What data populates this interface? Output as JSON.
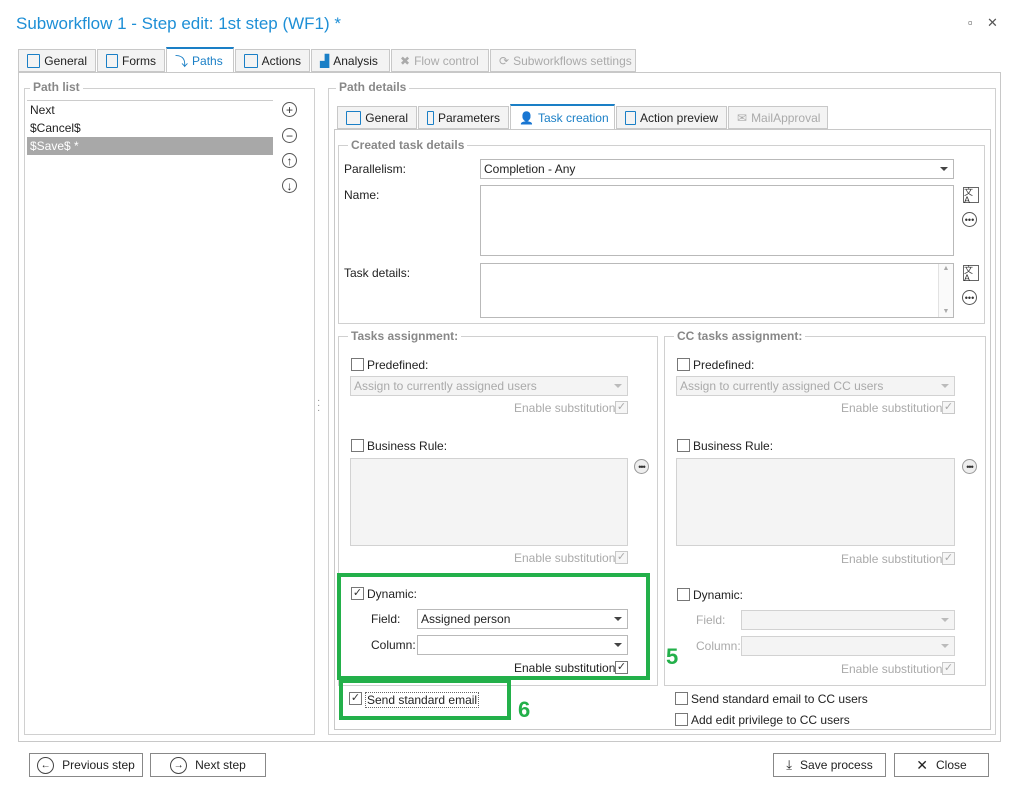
{
  "window": {
    "title": "Subworkflow 1 - Step edit: 1st step (WF1) *"
  },
  "main_tabs": [
    {
      "label": "General",
      "icon": "window-icon"
    },
    {
      "label": "Forms",
      "icon": "form-icon"
    },
    {
      "label": "Paths",
      "icon": "paths-icon",
      "active": true
    },
    {
      "label": "Actions",
      "icon": "actions-icon"
    },
    {
      "label": "Analysis",
      "icon": "analysis-icon"
    },
    {
      "label": "Flow control",
      "icon": "flow-control-icon",
      "disabled": true
    },
    {
      "label": "Subworkflows settings",
      "icon": "subworkflows-icon",
      "disabled": true
    }
  ],
  "path_list": {
    "title": "Path list",
    "items": [
      "Next",
      "$Cancel$",
      "$Save$ *"
    ],
    "selected_index": 2
  },
  "path_details": {
    "title": "Path details",
    "tabs": [
      {
        "label": "General"
      },
      {
        "label": "Parameters"
      },
      {
        "label": "Task creation",
        "active": true
      },
      {
        "label": "Action preview"
      },
      {
        "label": "MailApproval",
        "disabled": true
      }
    ],
    "created_task": {
      "title": "Created task details",
      "parallelism_label": "Parallelism:",
      "parallelism_value": "Completion - Any",
      "name_label": "Name:",
      "details_label": "Task details:"
    },
    "tasks_assignment": {
      "title": "Tasks assignment:",
      "predefined_label": "Predefined:",
      "predefined_checked": false,
      "predefined_value": "Assign to currently assigned users",
      "enable_substitutions": "Enable substitutions",
      "business_rule_label": "Business Rule:",
      "business_rule_checked": false,
      "dynamic_label": "Dynamic:",
      "dynamic_checked": true,
      "field_label": "Field:",
      "field_value": "Assigned person",
      "column_label": "Column:",
      "column_value": ""
    },
    "cc_assignment": {
      "title": "CC tasks assignment:",
      "predefined_label": "Predefined:",
      "predefined_value": "Assign to currently assigned CC users",
      "enable_substitutions": "Enable substitutions",
      "business_rule_label": "Business Rule:",
      "dynamic_label": "Dynamic:",
      "field_label": "Field:",
      "column_label": "Column:"
    },
    "send_standard_email": "Send standard email",
    "send_standard_email_checked": true,
    "send_cc_email": "Send standard email to CC users",
    "add_edit_privilege": "Add edit privilege to CC users"
  },
  "callouts": {
    "five": "5",
    "six": "6"
  },
  "footer": {
    "previous": "Previous step",
    "next": "Next step",
    "save": "Save process",
    "close": "Close"
  },
  "colors": {
    "accent": "#1a7fc6",
    "highlight": "#23b04a"
  }
}
